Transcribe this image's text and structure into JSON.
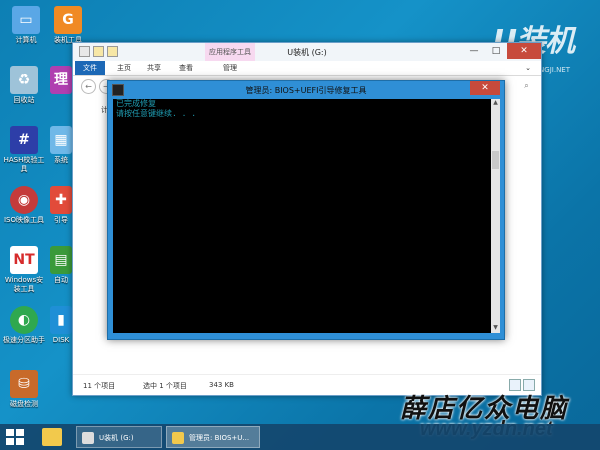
{
  "desktop": {
    "brand": "U装机",
    "brand_sub": "UZHUANGJI.NET",
    "icons": [
      {
        "label": "计算机",
        "icon": "computer-icon",
        "color": "#5aa7e6"
      },
      {
        "label": "装机工具",
        "icon": "uzhuangji-tool-icon",
        "color": "#f08a24"
      },
      {
        "label": "回收站",
        "icon": "recycle-bin-icon",
        "color": "#9ec3d9"
      },
      {
        "label": "理",
        "icon": "manager-icon",
        "color": "#b03fb0"
      },
      {
        "label": "HASH校验工具",
        "icon": "hash-tool-icon",
        "color": "#2d3ea8"
      },
      {
        "label": "系统",
        "icon": "system-tool-icon",
        "color": "#6fb8e8"
      },
      {
        "label": "ISO映像工具",
        "icon": "iso-tool-icon",
        "color": "#c43b3b"
      },
      {
        "label": "引导",
        "icon": "boot-tool-icon",
        "color": "#e24b3a"
      },
      {
        "label": "Windows安装工具",
        "icon": "windows-install-icon",
        "color": "#d62b2b"
      },
      {
        "label": "自动",
        "icon": "auto-tool-icon",
        "color": "#3a9a3a"
      },
      {
        "label": "极速分区助手",
        "icon": "partition-icon",
        "color": "#2fa84f"
      },
      {
        "label": "DISK",
        "icon": "disk-tool-icon",
        "color": "#1f8fd6"
      },
      {
        "label": "磁盘检测",
        "icon": "disk-check-icon",
        "color": "#c86a2a"
      }
    ]
  },
  "explorer": {
    "title": "U装机 (G:)",
    "context_tab_group": "应用程序工具",
    "tabs": [
      "文件",
      "主页",
      "共享",
      "查看",
      "管理"
    ],
    "left_item": "计",
    "status": {
      "count": "11 个项目",
      "selected": "选中 1 个项目",
      "size": "343 KB"
    },
    "controls": {
      "min": "—",
      "max": "□",
      "close": "✕"
    }
  },
  "console": {
    "title": "管理员: BIOS+UEFI引导修复工具",
    "lines": [
      "已完成修复",
      "请按任意键继续. . ."
    ],
    "close": "✕"
  },
  "watermark": {
    "text": "薛店亿众电脑",
    "url": "www.yzdn.net"
  },
  "taskbar": {
    "items": [
      {
        "label": "U装机 (G:)"
      },
      {
        "label": "管理员: BIOS+U..."
      }
    ]
  }
}
